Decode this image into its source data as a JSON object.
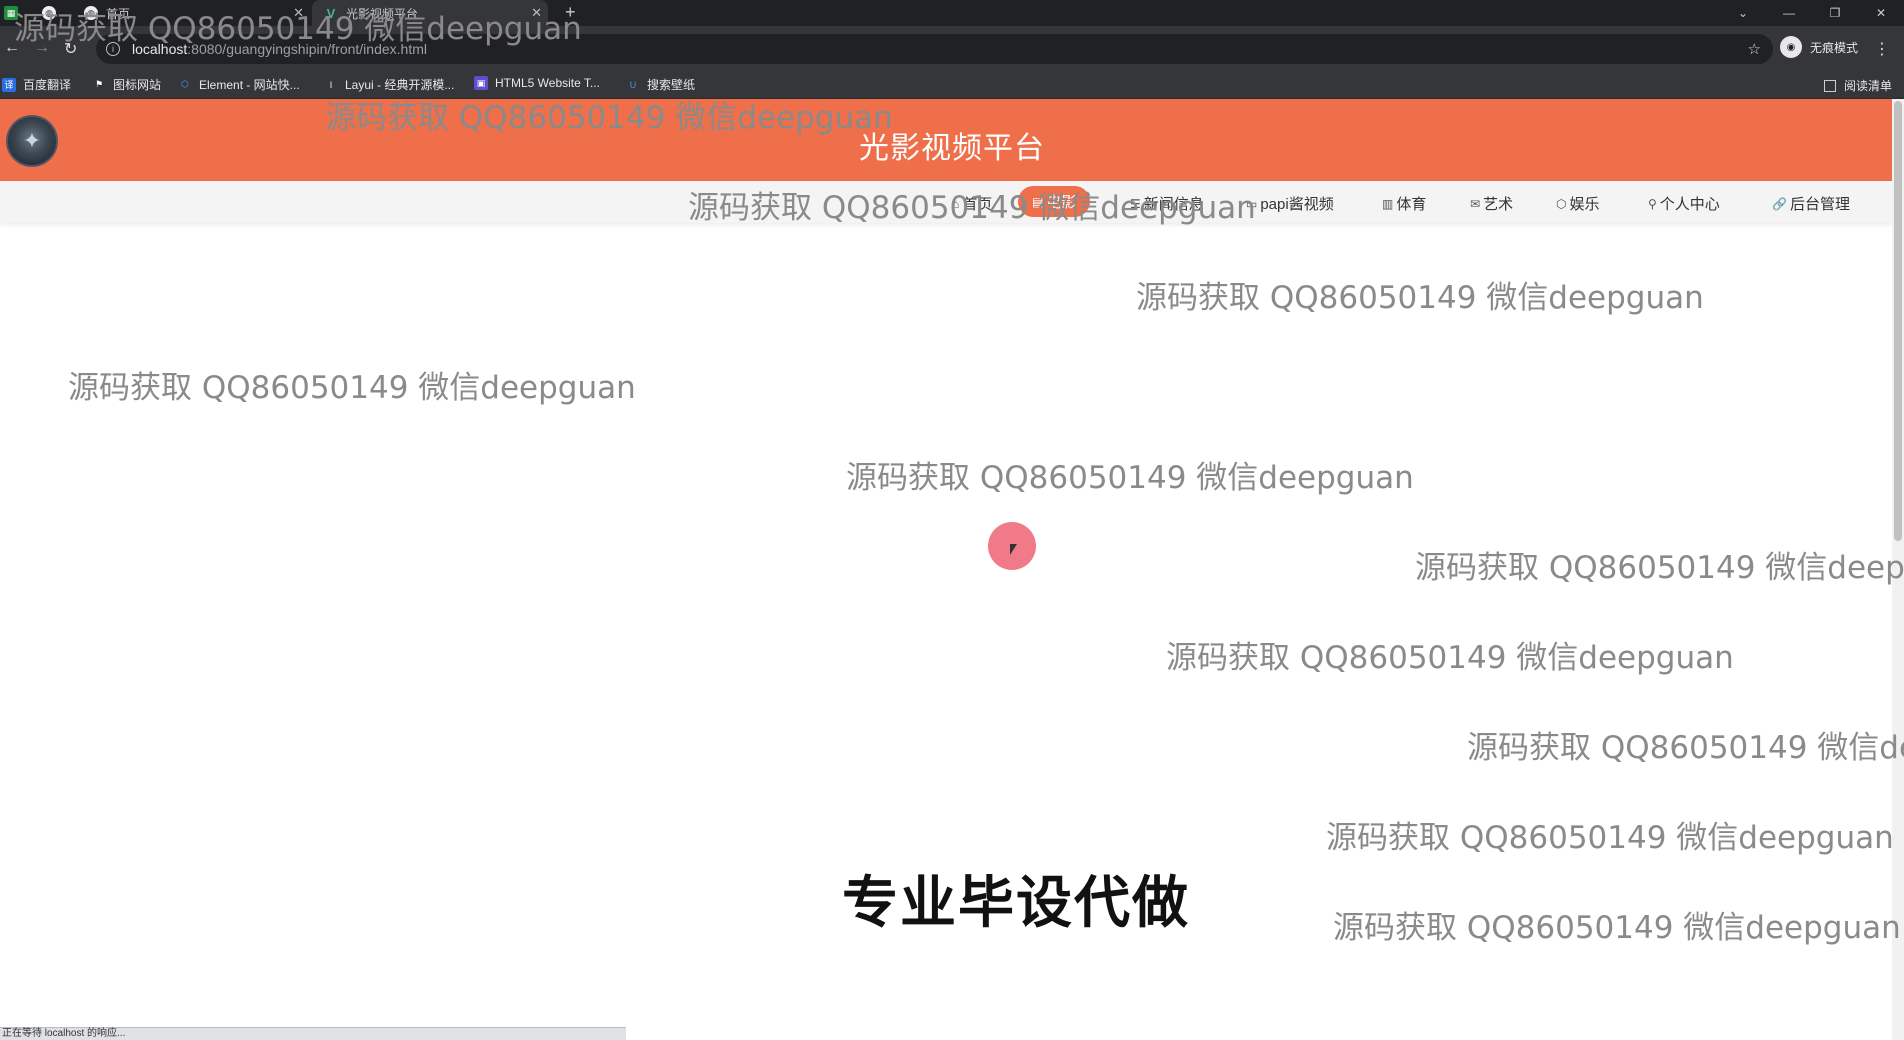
{
  "browser": {
    "tabs": [
      {
        "label": ""
      },
      {
        "label": "首页"
      },
      {
        "label": "光影视频平台"
      }
    ],
    "url_host": "localhost",
    "url_path": ":8080/guangyingshipin/front/index.html",
    "incognito_label": "无痕模式",
    "bookmarks": [
      "百度翻译",
      "图标网站",
      "Element - 网站快...",
      "Layui - 经典开源模...",
      "HTML5 Website T...",
      "搜索壁纸"
    ],
    "reading_list": "阅读清单",
    "status_text": "正在等待 localhost 的响应..."
  },
  "site": {
    "title": "光影视频平台",
    "nav": [
      {
        "label": "首页",
        "icon": "home-icon"
      },
      {
        "label": "电影",
        "icon": "film-icon"
      },
      {
        "label": "新闻信息",
        "icon": "news-icon"
      },
      {
        "label": "papi酱视频",
        "icon": "video-icon"
      },
      {
        "label": "体育",
        "icon": "sport-icon"
      },
      {
        "label": "艺术",
        "icon": "art-icon"
      },
      {
        "label": "娱乐",
        "icon": "entertainment-icon"
      },
      {
        "label": "个人中心",
        "icon": "user-icon"
      },
      {
        "label": "后台管理",
        "icon": "link-icon"
      }
    ],
    "active_nav_index": 1
  },
  "overlay": {
    "watermark": "源码获取 QQ86050149 微信deepguan",
    "caption": "专业毕设代做"
  },
  "colors": {
    "header": "#ef6f4a",
    "accent": "#ef6f4a"
  }
}
